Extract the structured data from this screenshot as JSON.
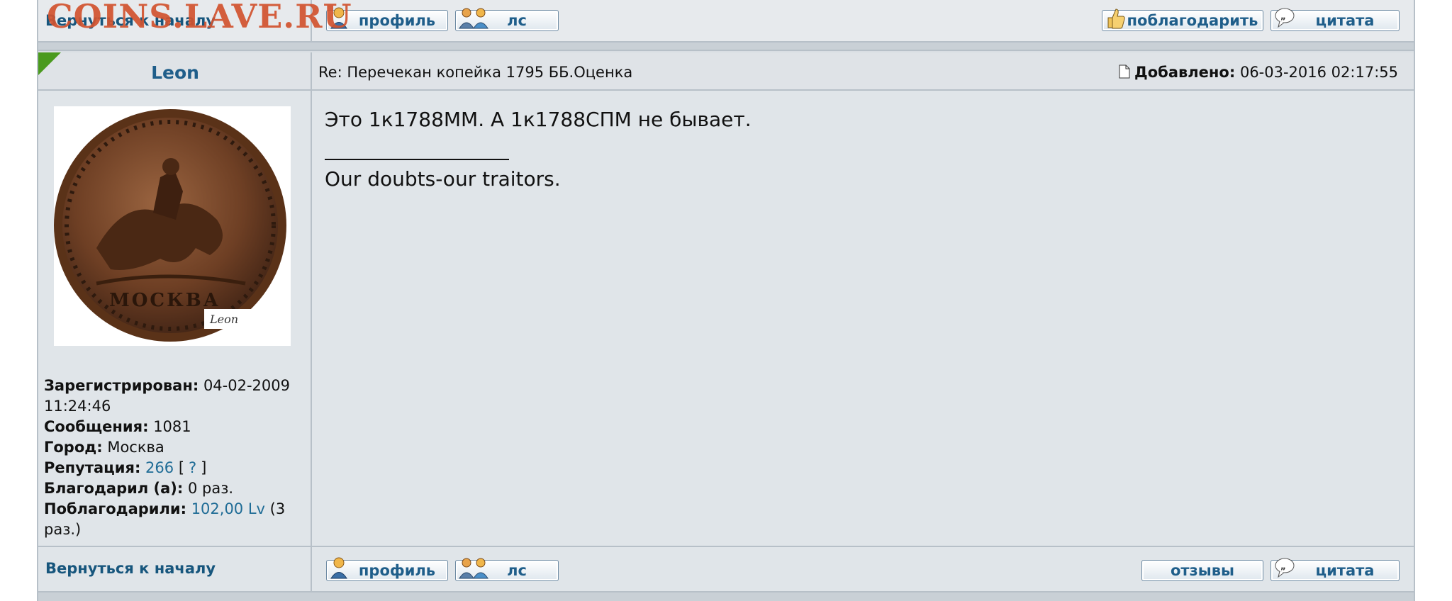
{
  "watermark": "COINS.LAVE.RU",
  "top_bar": {
    "back_label": "Вернуться к началу",
    "profile_label": "профиль",
    "pm_label": "лс",
    "thank_label": "поблагодарить",
    "quote_label": "цитата"
  },
  "post": {
    "author": "Leon",
    "subject": "Re: Перечекан копейка 1795 ББ.Оценка",
    "added_label": "Добавлено:",
    "added_value": "06-03-2016 02:17:55",
    "body_line": "Это 1к1788ММ. А 1к1788СПМ не бывает.",
    "signature": "Our doubts-our traitors.",
    "avatar_caption": "Leon",
    "avatar_legend": "МОСКВА"
  },
  "profile": {
    "registered_label": "Зарегистрирован:",
    "registered_value": "04-02-2009 11:24:46",
    "messages_label": "Сообщения:",
    "messages_value": "1081",
    "city_label": "Город:",
    "city_value": "Москва",
    "reputation_label": "Репутация:",
    "reputation_value": "266",
    "reputation_help": "?",
    "thanked_label": "Благодарил (а):",
    "thanked_value": "0 раз.",
    "thanked_by_label": "Поблагодарили:",
    "thanked_by_amount": "102,00 Lv",
    "thanked_by_count": "(3 раз.)"
  },
  "footer": {
    "back_label": "Вернуться к началу",
    "profile_label": "профиль",
    "pm_label": "лс",
    "reviews_label": "отзывы",
    "quote_label": "цитата"
  },
  "colors": {
    "link": "#17567d",
    "watermark": "#d2532f",
    "post_marker": "#4a9a1e"
  },
  "icons": [
    "user-icon",
    "users-icon",
    "thumbs-up-icon",
    "quote-bubble-icon",
    "document-icon"
  ]
}
